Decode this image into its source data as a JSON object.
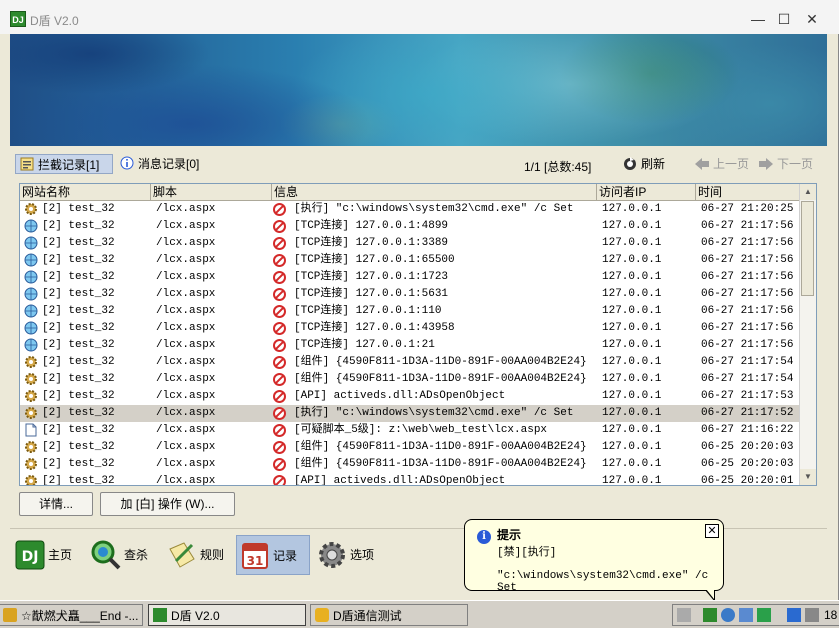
{
  "window": {
    "title": "D盾 V2.0",
    "min_label": "—",
    "max_label": "☐",
    "close_label": "✕"
  },
  "tabs": [
    {
      "label": "拦截记录[1]",
      "active": true,
      "icon": "shield-list-icon"
    },
    {
      "label": "消息记录[0]",
      "active": false,
      "icon": "info-icon"
    }
  ],
  "pager": {
    "text": "1/1 [总数:45]",
    "refresh_label": "刷新",
    "prev_label": "上一页",
    "next_label": "下一页"
  },
  "grid": {
    "columns": [
      "网站名称",
      "脚本",
      "信息",
      "访问者IP",
      "时间"
    ],
    "rows": [
      {
        "icon": "gear-icon",
        "site": "[2] test_32",
        "script": "/lcx.aspx",
        "info": "[执行] \"c:\\windows\\system32\\cmd.exe\" /c Set",
        "ip": "127.0.0.1",
        "time": "06-27 21:20:25",
        "selected": false
      },
      {
        "icon": "globe-icon",
        "site": "[2] test_32",
        "script": "/lcx.aspx",
        "info": "[TCP连接] 127.0.0.1:4899",
        "ip": "127.0.0.1",
        "time": "06-27 21:17:56",
        "selected": false
      },
      {
        "icon": "globe-icon",
        "site": "[2] test_32",
        "script": "/lcx.aspx",
        "info": "[TCP连接] 127.0.0.1:3389",
        "ip": "127.0.0.1",
        "time": "06-27 21:17:56",
        "selected": false
      },
      {
        "icon": "globe-icon",
        "site": "[2] test_32",
        "script": "/lcx.aspx",
        "info": "[TCP连接] 127.0.0.1:65500",
        "ip": "127.0.0.1",
        "time": "06-27 21:17:56",
        "selected": false
      },
      {
        "icon": "globe-icon",
        "site": "[2] test_32",
        "script": "/lcx.aspx",
        "info": "[TCP连接] 127.0.0.1:1723",
        "ip": "127.0.0.1",
        "time": "06-27 21:17:56",
        "selected": false
      },
      {
        "icon": "globe-icon",
        "site": "[2] test_32",
        "script": "/lcx.aspx",
        "info": "[TCP连接] 127.0.0.1:5631",
        "ip": "127.0.0.1",
        "time": "06-27 21:17:56",
        "selected": false
      },
      {
        "icon": "globe-icon",
        "site": "[2] test_32",
        "script": "/lcx.aspx",
        "info": "[TCP连接] 127.0.0.1:110",
        "ip": "127.0.0.1",
        "time": "06-27 21:17:56",
        "selected": false
      },
      {
        "icon": "globe-icon",
        "site": "[2] test_32",
        "script": "/lcx.aspx",
        "info": "[TCP连接] 127.0.0.1:43958",
        "ip": "127.0.0.1",
        "time": "06-27 21:17:56",
        "selected": false
      },
      {
        "icon": "globe-icon",
        "site": "[2] test_32",
        "script": "/lcx.aspx",
        "info": "[TCP连接] 127.0.0.1:21",
        "ip": "127.0.0.1",
        "time": "06-27 21:17:56",
        "selected": false
      },
      {
        "icon": "gear-icon",
        "site": "[2] test_32",
        "script": "/lcx.aspx",
        "info": "[组件] {4590F811-1D3A-11D0-891F-00AA004B2E24}",
        "ip": "127.0.0.1",
        "time": "06-27 21:17:54",
        "selected": false
      },
      {
        "icon": "gear-icon",
        "site": "[2] test_32",
        "script": "/lcx.aspx",
        "info": "[组件] {4590F811-1D3A-11D0-891F-00AA004B2E24}",
        "ip": "127.0.0.1",
        "time": "06-27 21:17:54",
        "selected": false
      },
      {
        "icon": "gear-icon",
        "site": "[2] test_32",
        "script": "/lcx.aspx",
        "info": "[API] activeds.dll:ADsOpenObject",
        "ip": "127.0.0.1",
        "time": "06-27 21:17:53",
        "selected": false
      },
      {
        "icon": "gear-icon",
        "site": "[2] test_32",
        "script": "/lcx.aspx",
        "info": "[执行] \"c:\\windows\\system32\\cmd.exe\" /c Set",
        "ip": "127.0.0.1",
        "time": "06-27 21:17:52",
        "selected": true
      },
      {
        "icon": "document-icon",
        "site": "[2] test_32",
        "script": "/lcx.aspx",
        "info": "[可疑脚本_5级]: z:\\web\\web_test\\lcx.aspx",
        "ip": "127.0.0.1",
        "time": "06-27 21:16:22",
        "selected": false
      },
      {
        "icon": "gear-icon",
        "site": "[2] test_32",
        "script": "/lcx.aspx",
        "info": "[组件] {4590F811-1D3A-11D0-891F-00AA004B2E24}",
        "ip": "127.0.0.1",
        "time": "06-25 20:20:03",
        "selected": false
      },
      {
        "icon": "gear-icon",
        "site": "[2] test_32",
        "script": "/lcx.aspx",
        "info": "[组件] {4590F811-1D3A-11D0-891F-00AA004B2E24}",
        "ip": "127.0.0.1",
        "time": "06-25 20:20:03",
        "selected": false
      },
      {
        "icon": "gear-icon",
        "site": "[2] test_32",
        "script": "/lcx.aspx",
        "info": "[API] activeds.dll:ADsOpenObject",
        "ip": "127.0.0.1",
        "time": "06-25 20:20:01",
        "selected": false
      }
    ]
  },
  "actions": {
    "details_label": "详情...",
    "whitelist_label": "加 [白] 操作 (W)..."
  },
  "nav": [
    {
      "label": "主页",
      "icon": "d-shield-logo-icon",
      "active": false
    },
    {
      "label": "查杀",
      "icon": "magnifier-scan-icon",
      "active": false
    },
    {
      "label": "规则",
      "icon": "rules-pencil-icon",
      "active": false
    },
    {
      "label": "记录",
      "icon": "calendar-log-icon",
      "active": true
    },
    {
      "label": "选项",
      "icon": "gear-options-icon",
      "active": false
    }
  ],
  "balloon": {
    "title": "提示",
    "line1": "[禁][执行]",
    "line2": "\"c:\\windows\\system32\\cmd.exe\" /c Set",
    "close_label": "✕"
  },
  "taskbar": {
    "buttons": [
      {
        "label": "☆猷燃犬矗___End -...",
        "icon": "app-icon",
        "pressed": false
      },
      {
        "label": "D盾 V2.0",
        "icon": "d-shield-icon",
        "pressed": true
      },
      {
        "label": "D盾通信测试",
        "icon": "d-shield-test-icon",
        "pressed": false
      }
    ],
    "clock": "18"
  }
}
